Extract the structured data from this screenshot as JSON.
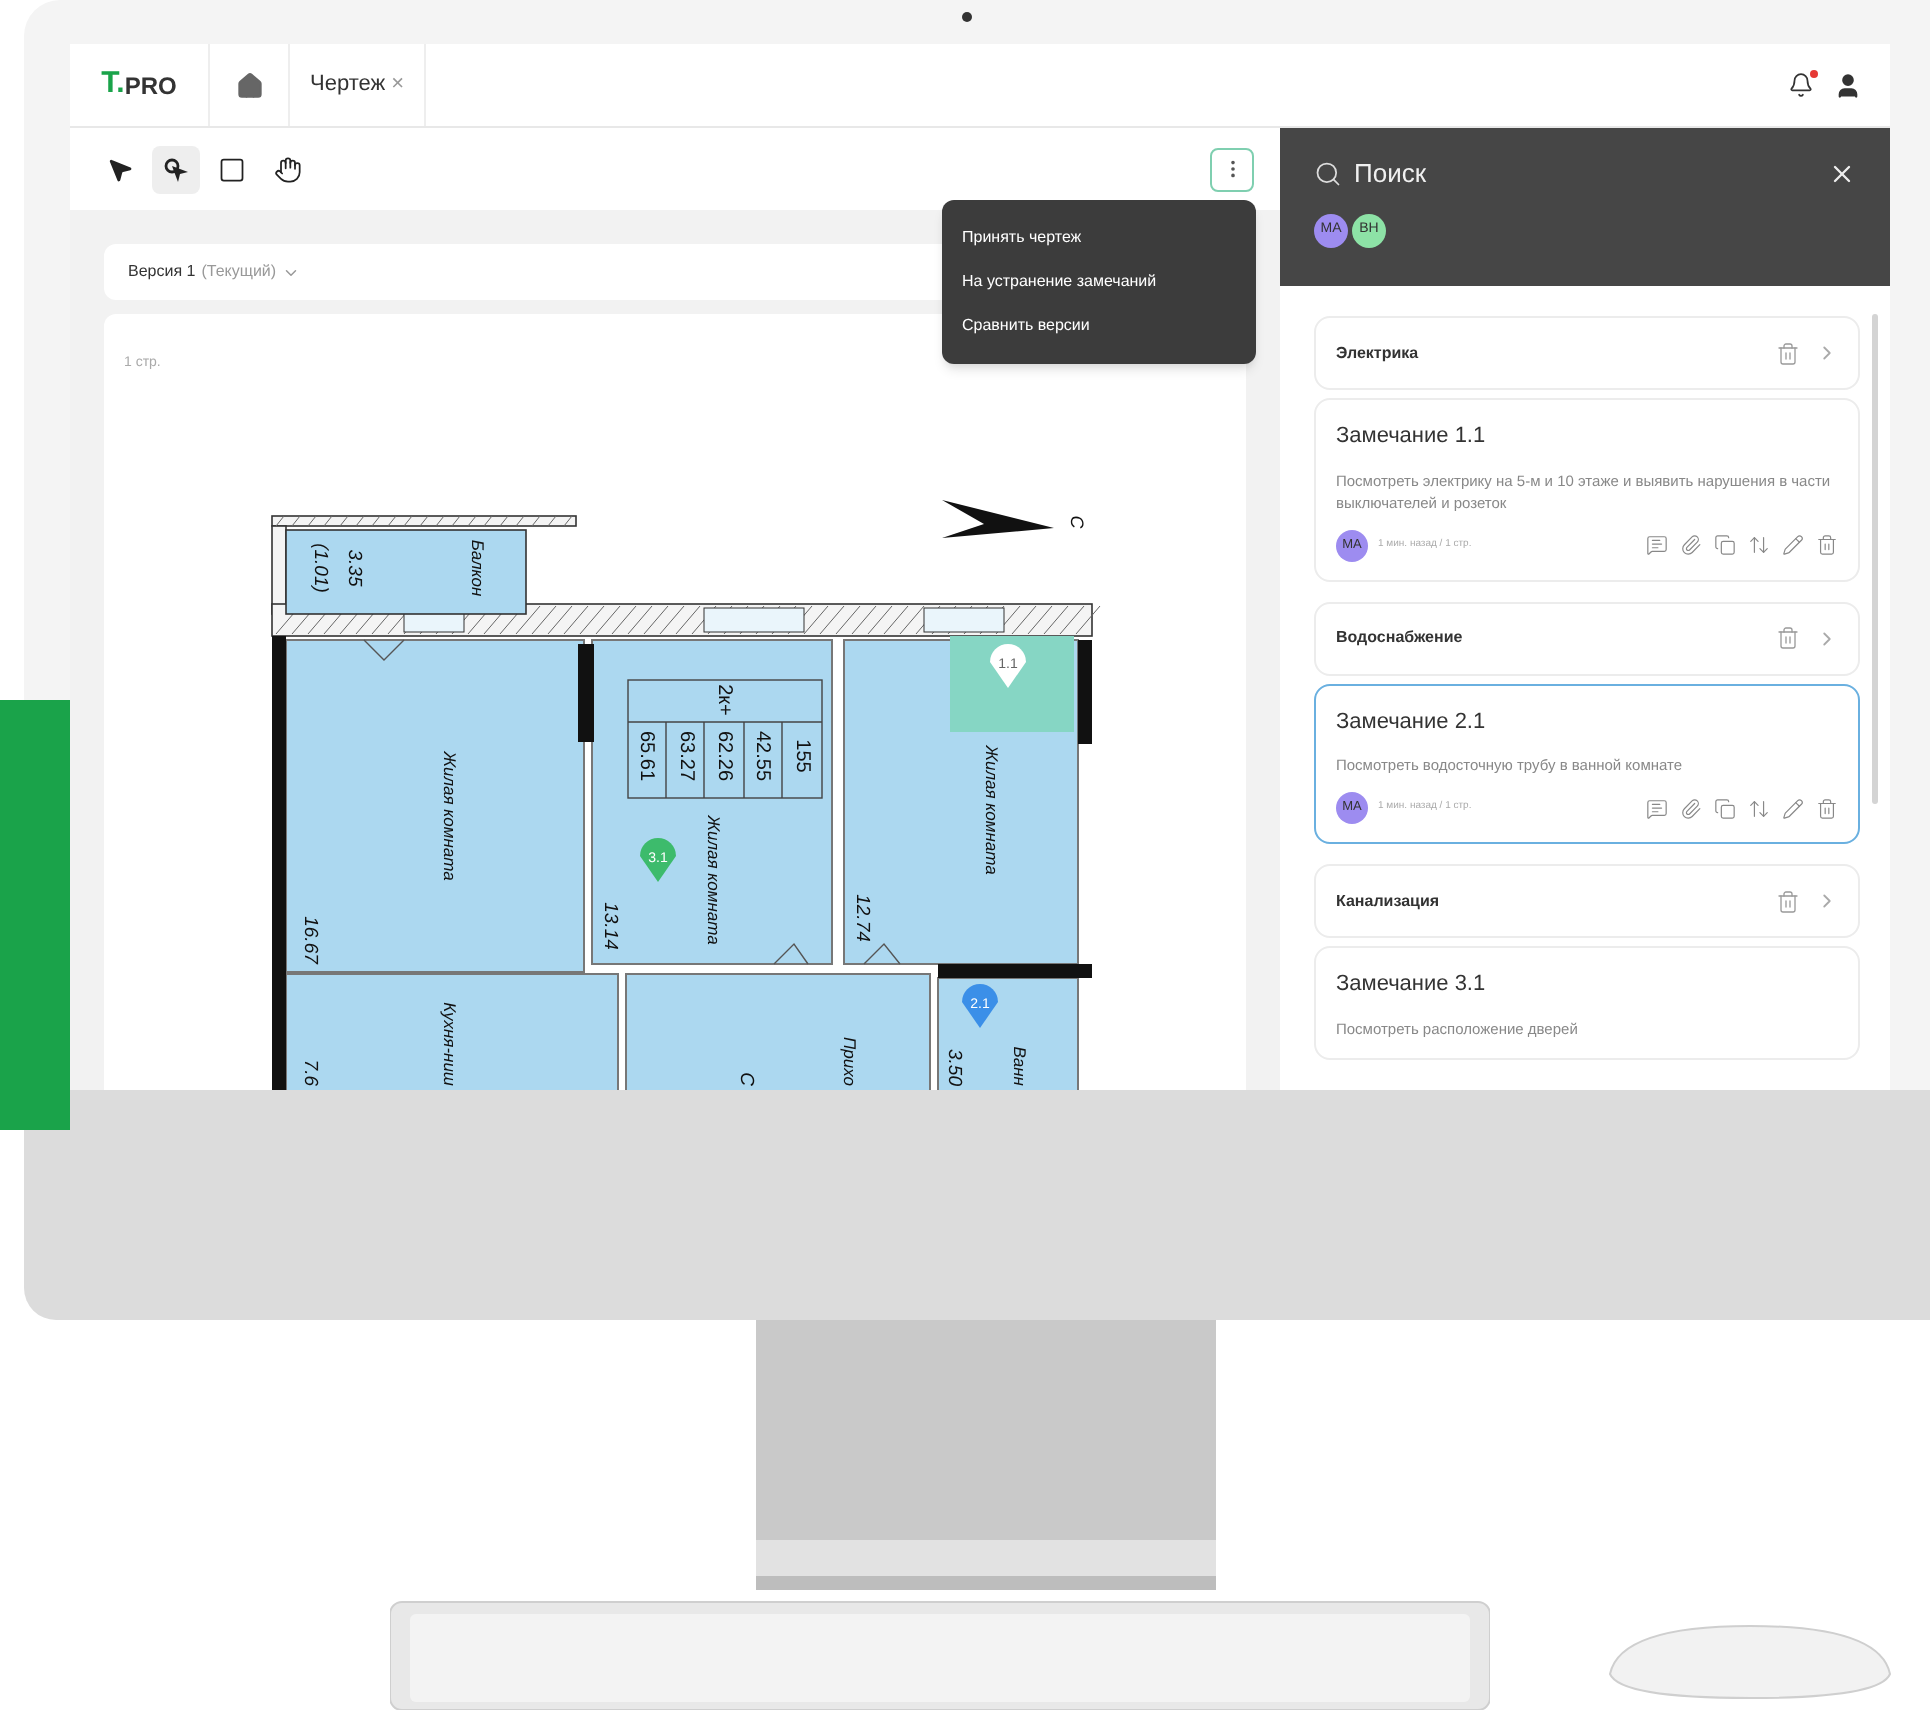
{
  "logo": {
    "mark": "T.",
    "text": "PRO"
  },
  "tabs": [
    {
      "kind": "home"
    },
    {
      "kind": "doc",
      "label": "Чертеж",
      "close": "×"
    }
  ],
  "notifications": {
    "unread": true
  },
  "tools": [
    {
      "kind": "pointer",
      "selected": false
    },
    {
      "kind": "node",
      "selected": true
    },
    {
      "kind": "rect",
      "selected": false
    },
    {
      "kind": "hand",
      "selected": false
    }
  ],
  "menu": {
    "items": [
      "Принять чертеж",
      "На устранение замечаний",
      "Сравнить версии"
    ]
  },
  "version": {
    "label": "Версия 1",
    "note": "(Текущий)"
  },
  "page_label": "1 стр.",
  "plan": {
    "labels": [
      "Балкон",
      "3.35",
      "(1.01)",
      "Жилая комната",
      "16.67",
      "Жилая комната",
      "13.14",
      "Жилая комната",
      "12.74",
      "2к+",
      "65.61",
      "63.27",
      "62.26",
      "42.55",
      "155",
      "С",
      "Кухня-ниш",
      "7.6",
      "С",
      "Прихо",
      "3.50",
      "Ванн"
    ],
    "pins": [
      {
        "label": "1.1",
        "color": "#ffffff"
      },
      {
        "label": "3.1",
        "color": "#3dbb6c"
      },
      {
        "label": "2.1",
        "color": "#3b8fe8"
      }
    ]
  },
  "panel": {
    "search_placeholder": "Поиск",
    "avatars": [
      {
        "initials": "МА",
        "color": "#9d8cf0"
      },
      {
        "initials": "ВН",
        "color": "#8de2a6"
      }
    ],
    "groups": [
      {
        "title": "Электрика",
        "comments": [
          {
            "title": "Замечание 1.1",
            "text": "Посмотреть электрику на 5-м и 10 этаже и выявить нарушения в части выключателей и розеток",
            "author": "МА",
            "meta": "1 мин. назад / 1 стр.",
            "selected": false
          }
        ]
      },
      {
        "title": "Водоснабжение",
        "comments": [
          {
            "title": "Замечание 2.1",
            "text": "Посмотреть водосточную трубу в ванной комнате",
            "author": "МА",
            "meta": "1 мин. назад / 1 стр.",
            "selected": true
          }
        ]
      },
      {
        "title": "Канализация",
        "comments": [
          {
            "title": "Замечание 3.1",
            "text": "Посмотреть расположение дверей",
            "selected": false
          }
        ]
      }
    ]
  }
}
